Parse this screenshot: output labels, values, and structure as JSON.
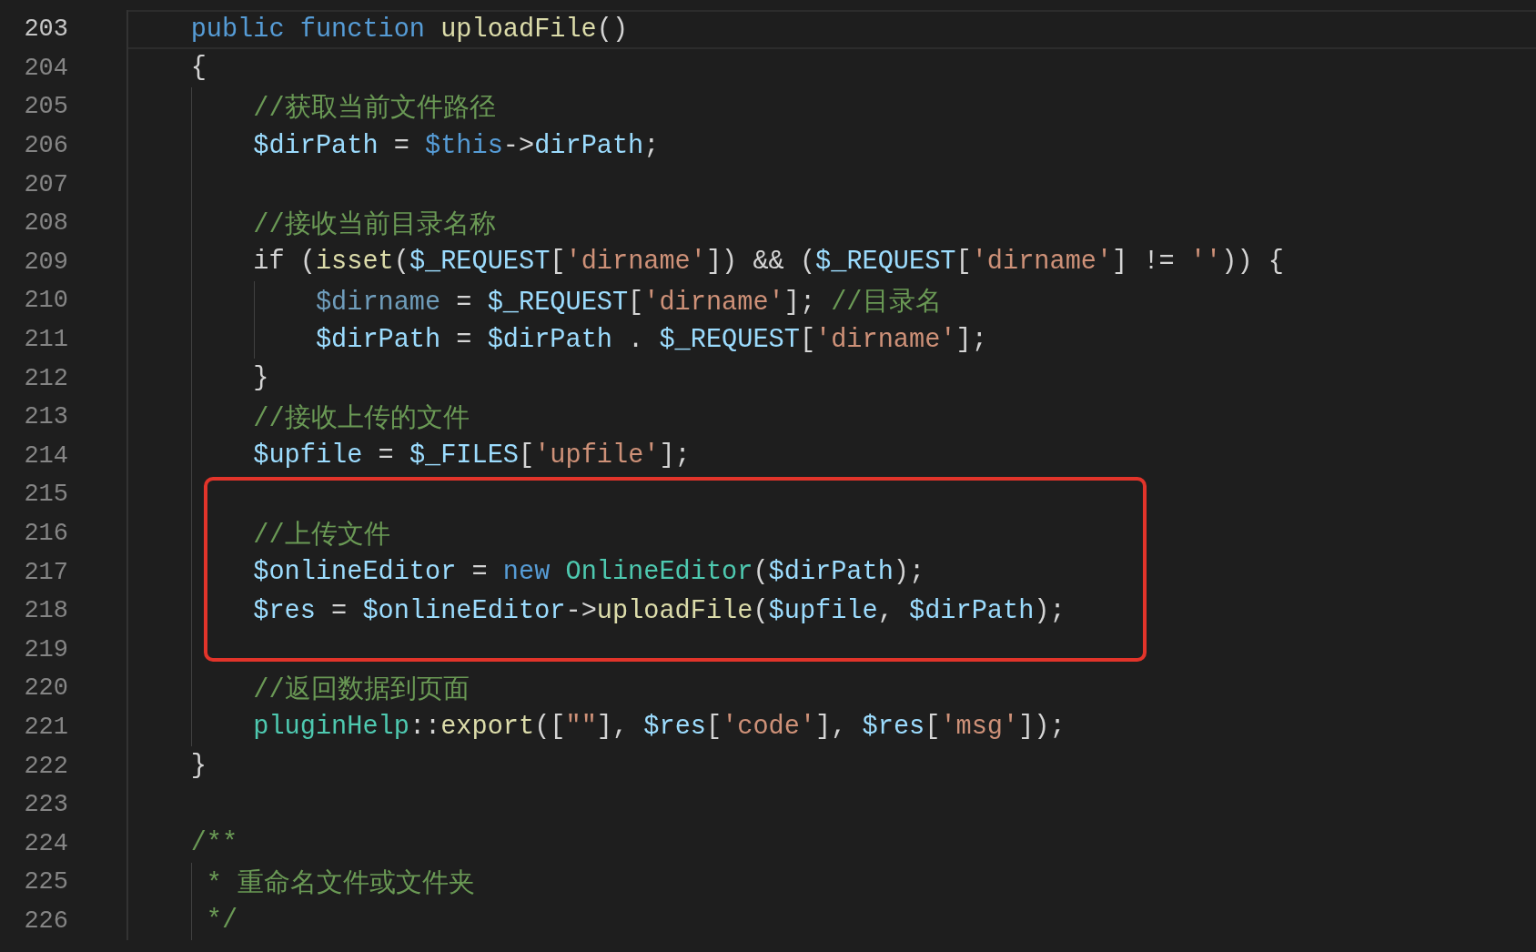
{
  "editor": {
    "lines": [
      {
        "number": "203",
        "current": true,
        "boxed": false,
        "tokens": [
          {
            "kind": "kw",
            "text": "    public"
          },
          {
            "kind": "kw",
            "text": " function"
          },
          {
            "kind": "fn",
            "text": " uploadFile"
          },
          {
            "kind": "plain",
            "text": "()"
          }
        ]
      },
      {
        "number": "204",
        "current": false,
        "boxed": false,
        "tokens": [
          {
            "kind": "plain",
            "text": "    {"
          }
        ]
      },
      {
        "number": "205",
        "current": false,
        "boxed": false,
        "tokens": [
          {
            "kind": "cmt",
            "text": "        //获取当前文件路径"
          }
        ]
      },
      {
        "number": "206",
        "current": false,
        "boxed": false,
        "tokens": [
          {
            "kind": "var",
            "text": "        $dirPath"
          },
          {
            "kind": "plain",
            "text": " = "
          },
          {
            "kind": "this",
            "text": "$this"
          },
          {
            "kind": "plain",
            "text": "->"
          },
          {
            "kind": "var",
            "text": "dirPath"
          },
          {
            "kind": "plain",
            "text": ";"
          }
        ]
      },
      {
        "number": "207",
        "current": false,
        "boxed": false
      },
      {
        "number": "208",
        "current": false,
        "boxed": false,
        "tokens": [
          {
            "kind": "cmt",
            "text": "        //接收当前目录名称"
          }
        ]
      },
      {
        "number": "209",
        "current": false,
        "boxed": false,
        "tokens": [
          {
            "kind": "plain",
            "text": "        if ("
          },
          {
            "kind": "fn",
            "text": "isset"
          },
          {
            "kind": "plain",
            "text": "("
          },
          {
            "kind": "var",
            "text": "$_REQUEST"
          },
          {
            "kind": "plain",
            "text": "["
          },
          {
            "kind": "str",
            "text": "'dirname'"
          },
          {
            "kind": "plain",
            "text": "]) && ("
          },
          {
            "kind": "var",
            "text": "$_REQUEST"
          },
          {
            "kind": "plain",
            "text": "["
          },
          {
            "kind": "str",
            "text": "'dirname'"
          },
          {
            "kind": "plain",
            "text": "] != "
          },
          {
            "kind": "str",
            "text": "''"
          },
          {
            "kind": "plain",
            "text": ")) {"
          }
        ]
      },
      {
        "number": "210",
        "current": false,
        "boxed": false,
        "tokens": [
          {
            "kind": "dim",
            "text": "            $dirname"
          },
          {
            "kind": "plain",
            "text": " = "
          },
          {
            "kind": "var",
            "text": "$_REQUEST"
          },
          {
            "kind": "plain",
            "text": "["
          },
          {
            "kind": "str",
            "text": "'dirname'"
          },
          {
            "kind": "plain",
            "text": "]; "
          },
          {
            "kind": "cmt",
            "text": "//目录名"
          }
        ]
      },
      {
        "number": "211",
        "current": false,
        "boxed": false,
        "tokens": [
          {
            "kind": "var",
            "text": "            $dirPath"
          },
          {
            "kind": "plain",
            "text": " = "
          },
          {
            "kind": "var",
            "text": "$dirPath"
          },
          {
            "kind": "plain",
            "text": " . "
          },
          {
            "kind": "var",
            "text": "$_REQUEST"
          },
          {
            "kind": "plain",
            "text": "["
          },
          {
            "kind": "str",
            "text": "'dirname'"
          },
          {
            "kind": "plain",
            "text": "];"
          }
        ]
      },
      {
        "number": "212",
        "current": false,
        "boxed": false,
        "tokens": [
          {
            "kind": "plain",
            "text": "        }"
          }
        ]
      },
      {
        "number": "213",
        "current": false,
        "boxed": false,
        "tokens": [
          {
            "kind": "cmt",
            "text": "        //接收上传的文件"
          }
        ]
      },
      {
        "number": "214",
        "current": false,
        "boxed": false,
        "tokens": [
          {
            "kind": "var",
            "text": "        $upfile"
          },
          {
            "kind": "plain",
            "text": " = "
          },
          {
            "kind": "var",
            "text": "$_FILES"
          },
          {
            "kind": "plain",
            "text": "["
          },
          {
            "kind": "str",
            "text": "'upfile'"
          },
          {
            "kind": "plain",
            "text": "];"
          }
        ]
      },
      {
        "number": "215",
        "current": false,
        "boxed": true
      },
      {
        "number": "216",
        "current": false,
        "boxed": true,
        "tokens": [
          {
            "kind": "cmt",
            "text": "        //上传文件"
          }
        ]
      },
      {
        "number": "217",
        "current": false,
        "boxed": true,
        "tokens": [
          {
            "kind": "var",
            "text": "        $onlineEditor"
          },
          {
            "kind": "plain",
            "text": " = "
          },
          {
            "kind": "kw",
            "text": "new"
          },
          {
            "kind": "cls",
            "text": " OnlineEditor"
          },
          {
            "kind": "plain",
            "text": "("
          },
          {
            "kind": "var",
            "text": "$dirPath"
          },
          {
            "kind": "plain",
            "text": ");"
          }
        ]
      },
      {
        "number": "218",
        "current": false,
        "boxed": true,
        "tokens": [
          {
            "kind": "var",
            "text": "        $res"
          },
          {
            "kind": "plain",
            "text": " = "
          },
          {
            "kind": "var",
            "text": "$onlineEditor"
          },
          {
            "kind": "plain",
            "text": "->"
          },
          {
            "kind": "fn",
            "text": "uploadFile"
          },
          {
            "kind": "plain",
            "text": "("
          },
          {
            "kind": "var",
            "text": "$upfile"
          },
          {
            "kind": "plain",
            "text": ", "
          },
          {
            "kind": "var",
            "text": "$dirPath"
          },
          {
            "kind": "plain",
            "text": ");"
          }
        ]
      },
      {
        "number": "219",
        "current": false,
        "boxed": true
      },
      {
        "number": "220",
        "current": false,
        "boxed": false,
        "tokens": [
          {
            "kind": "cmt",
            "text": "        //返回数据到页面"
          }
        ]
      },
      {
        "number": "221",
        "current": false,
        "boxed": false,
        "tokens": [
          {
            "kind": "cls",
            "text": "        pluginHelp"
          },
          {
            "kind": "plain",
            "text": "::"
          },
          {
            "kind": "fn",
            "text": "export"
          },
          {
            "kind": "plain",
            "text": "(["
          },
          {
            "kind": "str",
            "text": "\"\""
          },
          {
            "kind": "plain",
            "text": "], "
          },
          {
            "kind": "var",
            "text": "$res"
          },
          {
            "kind": "plain",
            "text": "["
          },
          {
            "kind": "str",
            "text": "'code'"
          },
          {
            "kind": "plain",
            "text": "], "
          },
          {
            "kind": "var",
            "text": "$res"
          },
          {
            "kind": "plain",
            "text": "["
          },
          {
            "kind": "str",
            "text": "'msg'"
          },
          {
            "kind": "plain",
            "text": "]);"
          }
        ]
      },
      {
        "number": "222",
        "current": false,
        "boxed": false,
        "tokens": [
          {
            "kind": "plain",
            "text": "    }"
          }
        ]
      },
      {
        "number": "223",
        "current": false,
        "boxed": false
      },
      {
        "number": "224",
        "current": false,
        "boxed": false,
        "tokens": [
          {
            "kind": "cmt",
            "text": "    /**"
          }
        ]
      },
      {
        "number": "225",
        "current": false,
        "boxed": false,
        "tokens": [
          {
            "kind": "cmt",
            "text": "     * 重命名文件或文件夹"
          }
        ]
      },
      {
        "number": "226",
        "current": false,
        "boxed": false,
        "tokens": [
          {
            "kind": "cmt",
            "text": "     */"
          }
        ]
      }
    ]
  }
}
